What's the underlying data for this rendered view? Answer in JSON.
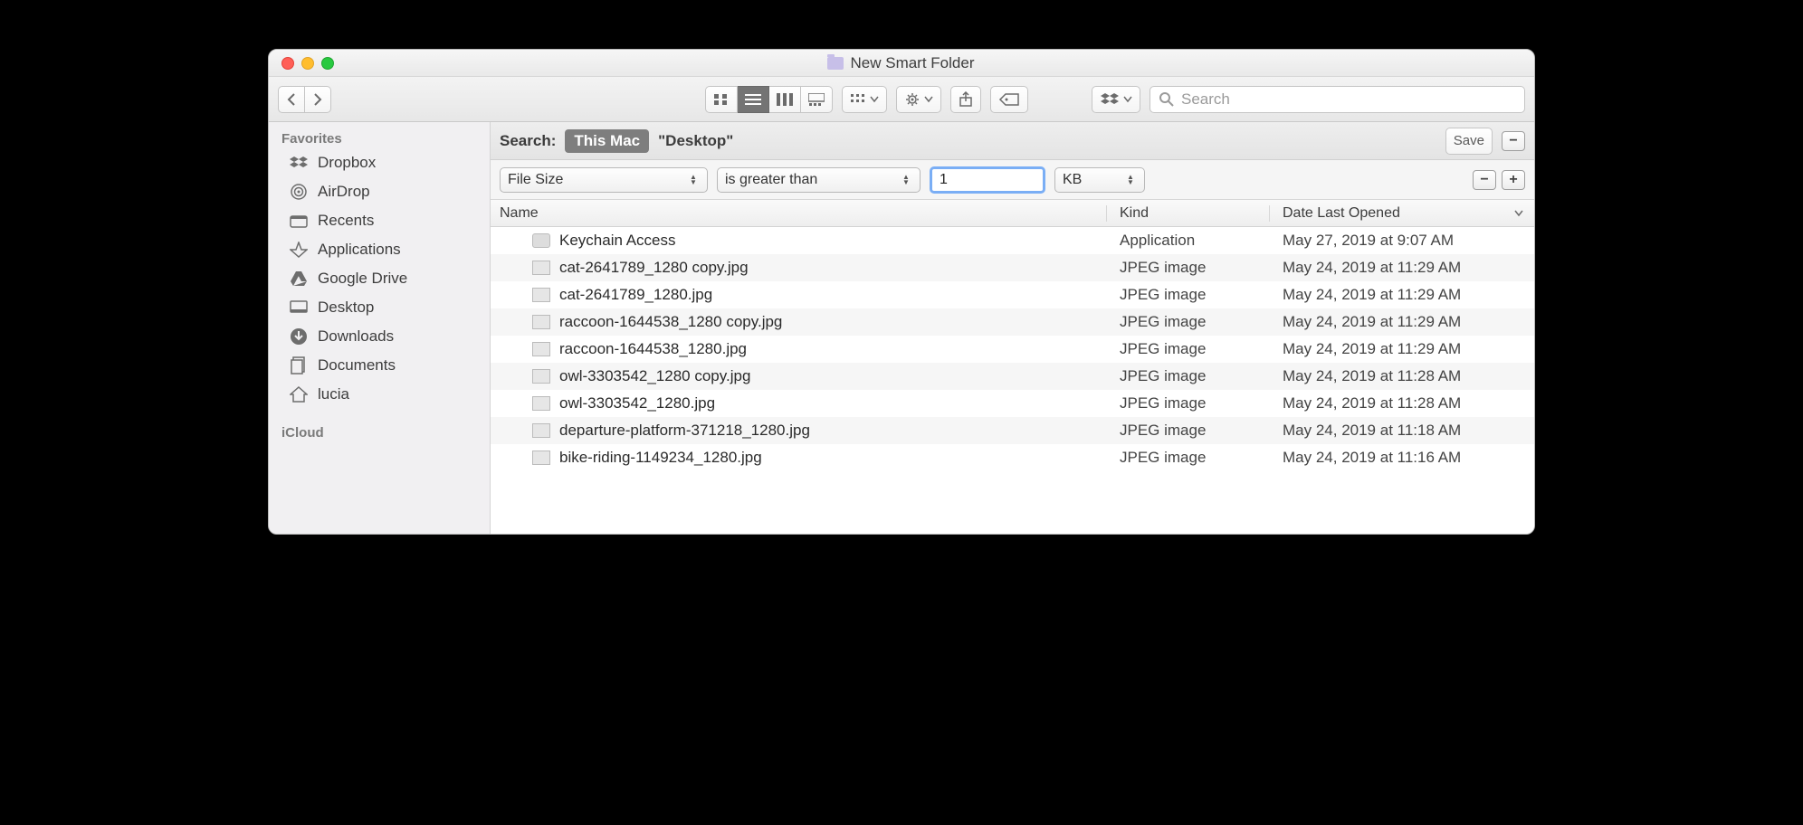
{
  "window": {
    "title": "New Smart Folder"
  },
  "toolbar": {
    "search_placeholder": "Search"
  },
  "sidebar": {
    "favorites_label": "Favorites",
    "iCloud_label": "iCloud",
    "items": [
      {
        "label": "Dropbox"
      },
      {
        "label": "AirDrop"
      },
      {
        "label": "Recents"
      },
      {
        "label": "Applications"
      },
      {
        "label": "Google Drive"
      },
      {
        "label": "Desktop"
      },
      {
        "label": "Downloads"
      },
      {
        "label": "Documents"
      },
      {
        "label": "lucia"
      }
    ]
  },
  "searchbar": {
    "label": "Search:",
    "scope_active": "This Mac",
    "scope_alt": "\"Desktop\"",
    "save_label": "Save"
  },
  "criteria": {
    "attribute": "File Size",
    "operator": "is greater than",
    "value": "1",
    "unit": "KB"
  },
  "columns": {
    "name": "Name",
    "kind": "Kind",
    "date": "Date Last Opened"
  },
  "rows": [
    {
      "name": "Keychain Access",
      "kind": "Application",
      "date": "May 27, 2019 at 9:07 AM",
      "icon": "app"
    },
    {
      "name": "cat-2641789_1280 copy.jpg",
      "kind": "JPEG image",
      "date": "May 24, 2019 at 11:29 AM",
      "icon": "img"
    },
    {
      "name": "cat-2641789_1280.jpg",
      "kind": "JPEG image",
      "date": "May 24, 2019 at 11:29 AM",
      "icon": "img"
    },
    {
      "name": "raccoon-1644538_1280 copy.jpg",
      "kind": "JPEG image",
      "date": "May 24, 2019 at 11:29 AM",
      "icon": "img"
    },
    {
      "name": "raccoon-1644538_1280.jpg",
      "kind": "JPEG image",
      "date": "May 24, 2019 at 11:29 AM",
      "icon": "img"
    },
    {
      "name": "owl-3303542_1280 copy.jpg",
      "kind": "JPEG image",
      "date": "May 24, 2019 at 11:28 AM",
      "icon": "img"
    },
    {
      "name": "owl-3303542_1280.jpg",
      "kind": "JPEG image",
      "date": "May 24, 2019 at 11:28 AM",
      "icon": "img"
    },
    {
      "name": "departure-platform-371218_1280.jpg",
      "kind": "JPEG image",
      "date": "May 24, 2019 at 11:18 AM",
      "icon": "img"
    },
    {
      "name": "bike-riding-1149234_1280.jpg",
      "kind": "JPEG image",
      "date": "May 24, 2019 at 11:16 AM",
      "icon": "img"
    }
  ]
}
